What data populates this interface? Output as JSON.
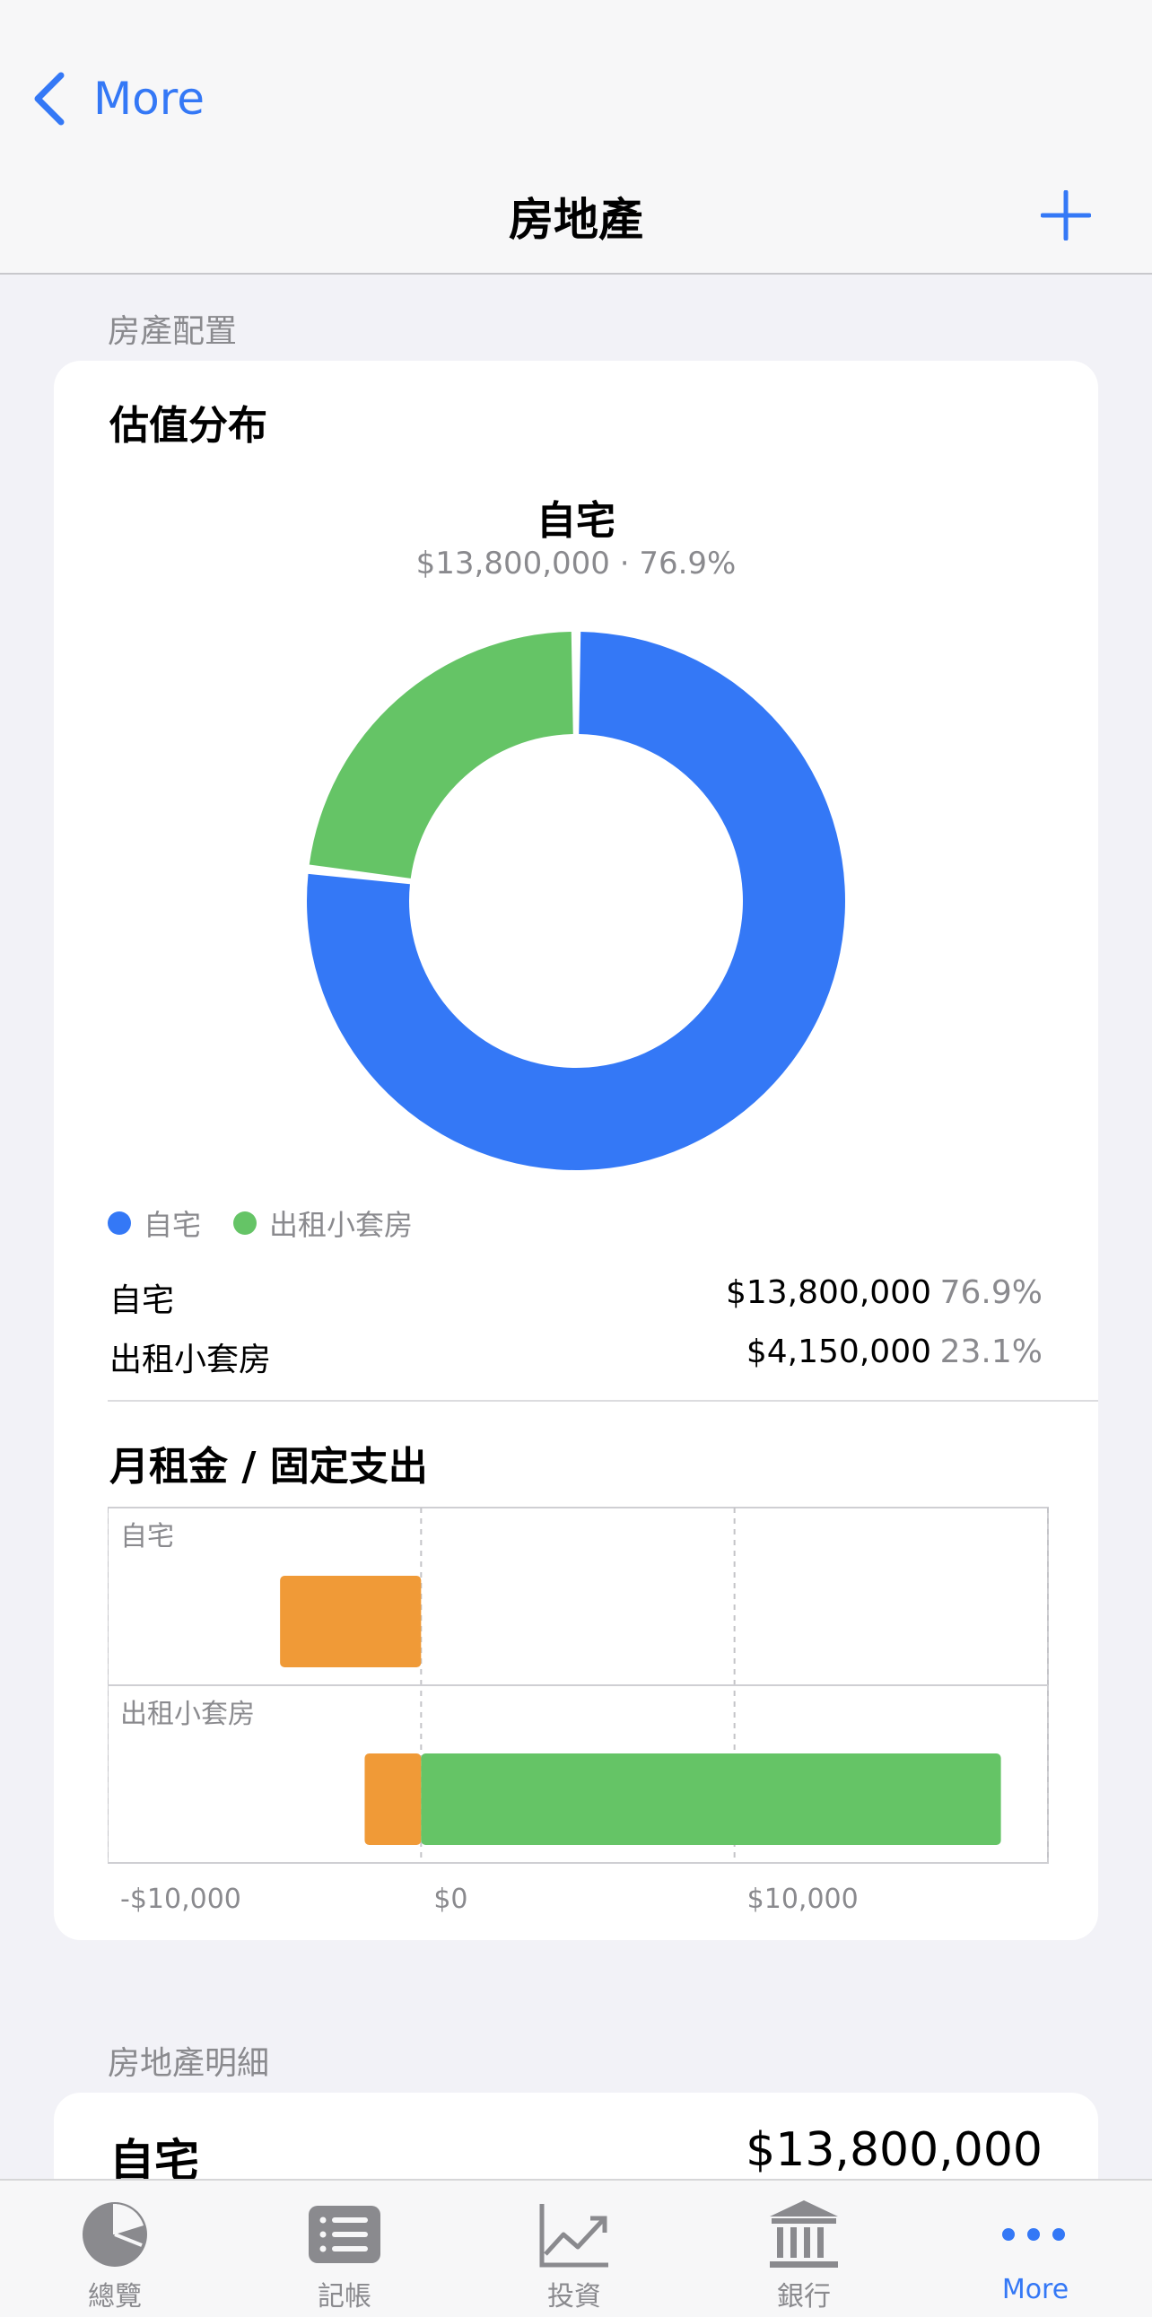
{
  "nav": {
    "back_label": "More",
    "title": "房地產"
  },
  "allocation": {
    "section_header": "房產配置",
    "card_title": "估值分布",
    "selected": {
      "name": "自宅",
      "info": "$13,800,000 · 76.9%"
    },
    "legend": [
      {
        "label": "自宅",
        "color": "#3478f6"
      },
      {
        "label": "出租小套房",
        "color": "#65c466"
      }
    ],
    "rows": [
      {
        "name": "自宅",
        "value": "$13,800,000",
        "pct": "76.9%"
      },
      {
        "name": "出租小套房",
        "value": "$4,150,000",
        "pct": "23.1%"
      }
    ]
  },
  "chart_data": [
    {
      "type": "pie",
      "labels": [
        "自宅",
        "出租小套房"
      ],
      "values": [
        13800000,
        4150000
      ],
      "percent": [
        76.9,
        23.1
      ],
      "colors": [
        "#3478f6",
        "#65c466"
      ],
      "title": "估值分布"
    },
    {
      "type": "bar",
      "title": "月租金 / 固定支出",
      "orientation": "horizontal",
      "categories": [
        "自宅",
        "出租小套房"
      ],
      "series": [
        {
          "name": "",
          "color": "#f09a37",
          "values": [
            -4500,
            -1800
          ]
        },
        {
          "name": "",
          "color": "#65c466",
          "values": [
            0,
            18500
          ]
        }
      ],
      "xlim": [
        -10000,
        20000
      ],
      "xticks": [
        "-$10,000",
        "$0",
        "$10,000"
      ],
      "grid": true
    }
  ],
  "rent": {
    "title": "月租金 / 固定支出"
  },
  "details": {
    "section_header": "房地產明細",
    "first_name": "自宅",
    "first_value": "$13,800,000"
  },
  "tabs": [
    {
      "label": "總覽",
      "icon": "pie-chart-icon"
    },
    {
      "label": "記帳",
      "icon": "list-icon"
    },
    {
      "label": "投資",
      "icon": "chart-line-icon"
    },
    {
      "label": "銀行",
      "icon": "bank-icon"
    },
    {
      "label": "More",
      "icon": "more-icon"
    }
  ],
  "colors": {
    "accent": "#3478f6",
    "green": "#65c466",
    "orange": "#f09a37"
  }
}
